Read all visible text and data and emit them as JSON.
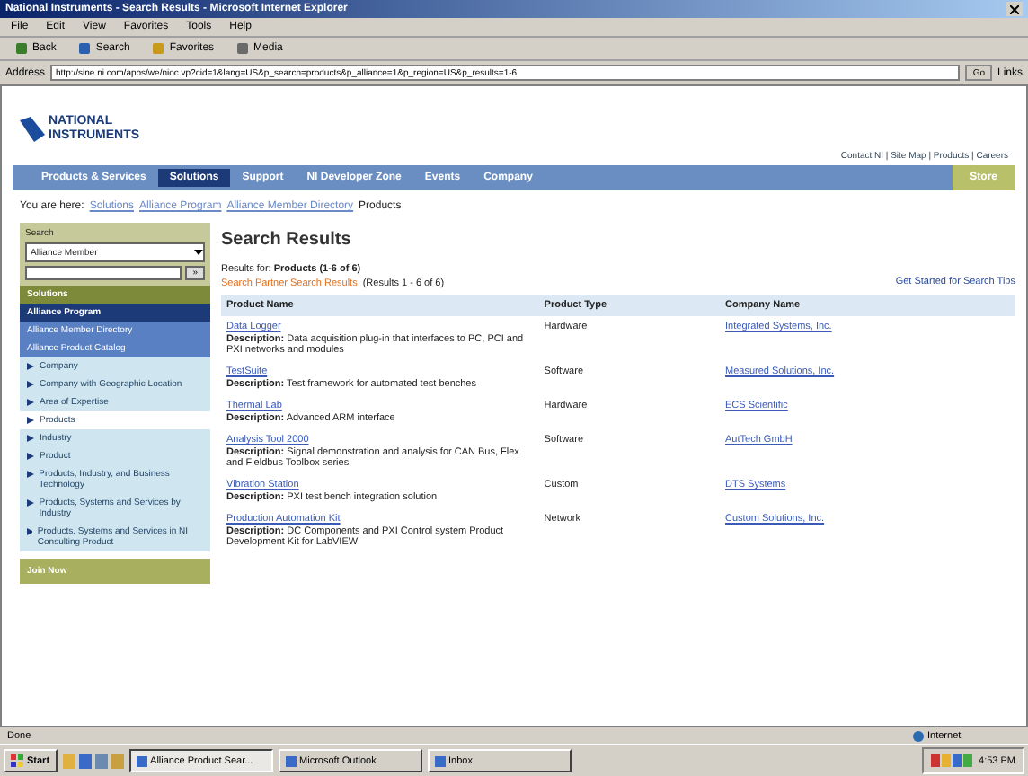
{
  "window": {
    "title": "National Instruments - Search Results - Microsoft Internet Explorer"
  },
  "menu": [
    "File",
    "Edit",
    "View",
    "Favorites",
    "Tools",
    "Help"
  ],
  "toolbar": [
    "Back",
    "Search",
    "Favorites",
    "Media"
  ],
  "address": {
    "label": "Address",
    "value": "http://sine.ni.com/apps/we/nioc.vp?cid=1&lang=US&p_search=products&p_alliance=1&p_region=US&p_results=1-6",
    "go": "Go",
    "links": "Links"
  },
  "site": {
    "logo": [
      "NATIONAL",
      "INSTRUMENTS"
    ],
    "util_links": "Contact NI | Site Map | Products | Careers",
    "nav": [
      {
        "label": "Products & Services",
        "selected": false
      },
      {
        "label": "Solutions",
        "selected": true
      },
      {
        "label": "Support",
        "selected": false
      },
      {
        "label": "NI Developer Zone",
        "selected": false
      },
      {
        "label": "Events",
        "selected": false
      },
      {
        "label": "Company",
        "selected": false
      }
    ],
    "nav_button": "Store",
    "breadcrumb": {
      "label": "You are here:",
      "items": [
        "Solutions",
        "Alliance Program",
        "Alliance Member Directory"
      ],
      "current": "Products"
    }
  },
  "sidebar": {
    "search_label": "Search",
    "select": "Alliance Member",
    "go": "»",
    "items": [
      {
        "label": "Solutions",
        "kind": "section",
        "selected": false
      },
      {
        "label": "Alliance Program",
        "kind": "header",
        "selected": false
      },
      {
        "label": "Alliance Member Directory",
        "kind": "sub",
        "selected": false
      },
      {
        "label": "Alliance Product Catalog",
        "kind": "sub",
        "selected": false
      },
      {
        "label": "Company",
        "kind": "link",
        "selected": false
      },
      {
        "label": "Company with Geographic Location",
        "kind": "link",
        "selected": false
      },
      {
        "label": "Area of Expertise",
        "kind": "link",
        "selected": false
      },
      {
        "label": "Products",
        "kind": "link",
        "selected": true
      },
      {
        "label": "Industry",
        "kind": "link",
        "selected": false
      },
      {
        "label": "Product",
        "kind": "link",
        "selected": false
      },
      {
        "label": "Products, Industry, and Business Technology",
        "kind": "link",
        "selected": false
      },
      {
        "label": "Products, Systems and Services by Industry",
        "kind": "link",
        "selected": false
      },
      {
        "label": "Products, Systems and Services in NI Consulting Product",
        "kind": "link",
        "selected": false
      }
    ],
    "footer": "Join Now"
  },
  "results": {
    "title": "Search Results",
    "summary": "Results for: **Products (1-6 of 6)**",
    "refine": "Search Partner Search Results",
    "range": "(Results 1 - 6 of 6)",
    "right_links": "Get Started for Search Tips",
    "columns": [
      "Product Name",
      "Product Type",
      "Company Name"
    ],
    "rows": [
      {
        "name": "Data Logger",
        "type": "Hardware",
        "company": "Integrated Systems, Inc.",
        "description": "**Description:** Data acquisition plug-in that interfaces to PC, PCI and PXI networks and modules"
      },
      {
        "name": "TestSuite",
        "type": "Software",
        "company": "Measured Solutions, Inc.",
        "description": "**Description:** Test framework for automated test benches"
      },
      {
        "name": "Thermal Lab",
        "type": "Hardware",
        "company": "ECS Scientific",
        "description": "**Description:** Advanced ARM interface"
      },
      {
        "name": "Analysis Tool 2000",
        "type": "Software",
        "company": "AutTech GmbH",
        "description": "**Description:** Signal demonstration and analysis for CAN Bus, Flex and Fieldbus Toolbox series"
      },
      {
        "name": "Vibration Station",
        "type": "Custom",
        "company": "DTS Systems",
        "description": "**Description:** PXI test bench integration solution"
      },
      {
        "name": "Production Automation Kit",
        "type": "Network",
        "company": "Custom Solutions, Inc.",
        "description": "**Description:** DC Components and PXI Control system Product Development Kit for LabVIEW"
      }
    ]
  },
  "status": {
    "left": "Done",
    "zone": "Internet"
  },
  "taskbar": {
    "start": "Start",
    "tasks": [
      {
        "label": "Alliance Product Sear...",
        "selected": true
      },
      {
        "label": "Microsoft Outlook",
        "selected": false
      },
      {
        "label": "Inbox",
        "selected": false
      }
    ],
    "clock": "4:53 PM"
  }
}
